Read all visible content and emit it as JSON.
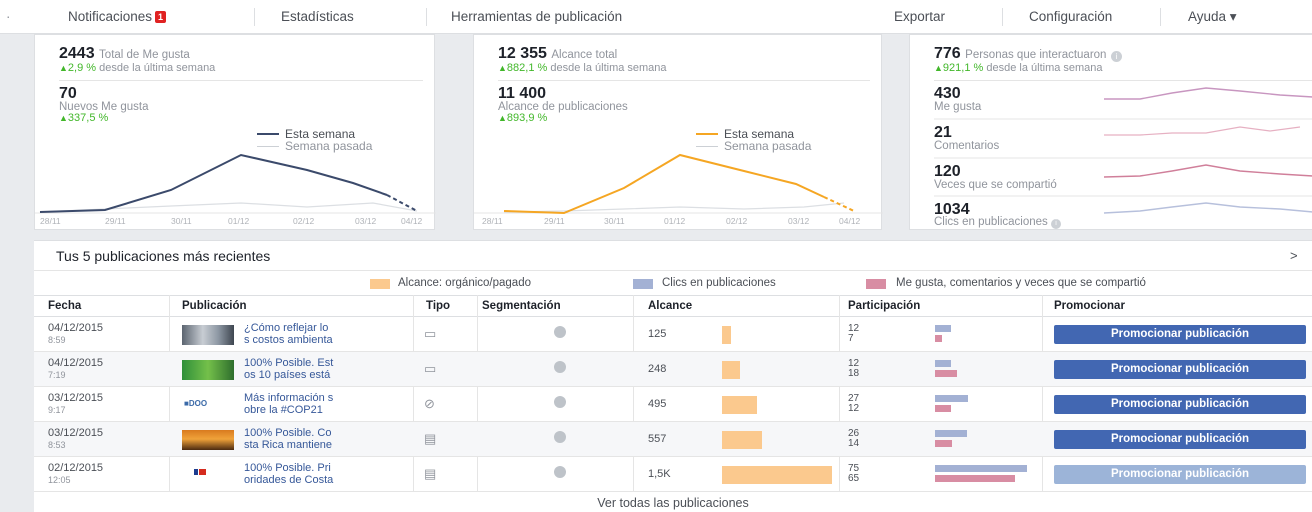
{
  "nav": {
    "notifications": "Notificaciones",
    "notifications_badge": "1",
    "stats": "Estadísticas",
    "publishing_tools": "Herramientas de publicación",
    "export": "Exportar",
    "settings": "Configuración",
    "help": "Ayuda ▾"
  },
  "likes_card": {
    "total_value": "2443",
    "total_label": "Total de Me gusta",
    "total_change": "2,9 %",
    "total_change_suffix": "desde la última semana",
    "new_value": "70",
    "new_label": "Nuevos Me gusta",
    "new_change": "337,5 %",
    "legend_this": "Esta semana",
    "legend_last": "Semana pasada",
    "axis": [
      "28/11",
      "29/11",
      "30/11",
      "01/12",
      "02/12",
      "03/12",
      "04/12"
    ],
    "line_color": "#3b4a6b"
  },
  "reach_card": {
    "total_value": "12 355",
    "total_label": "Alcance total",
    "total_change": "882,1 %",
    "total_change_suffix": "desde la última semana",
    "posts_value": "11 400",
    "posts_label": "Alcance de publicaciones",
    "posts_change": "893,9 %",
    "legend_this": "Esta semana",
    "legend_last": "Semana pasada",
    "axis": [
      "28/11",
      "29/11",
      "30/11",
      "01/12",
      "02/12",
      "03/12",
      "04/12"
    ],
    "line_color": "#f5a623"
  },
  "engagement_card": {
    "total_value": "776",
    "total_label": "Personas que interactuaron",
    "total_change": "921,1 %",
    "total_change_suffix": "desde la última semana",
    "items": [
      {
        "value": "430",
        "label": "Me gusta"
      },
      {
        "value": "21",
        "label": "Comentarios"
      },
      {
        "value": "120",
        "label": "Veces que se compartió"
      },
      {
        "value": "1034",
        "label": "Clics en publicaciones"
      }
    ]
  },
  "posts": {
    "title": "Tus 5 publicaciones más recientes",
    "chevron": ">",
    "legend": {
      "reach": "Alcance: orgánico/pagado",
      "clicks": "Clics en publicaciones",
      "reactions": "Me gusta, comentarios y veces que se compartió"
    },
    "colors": {
      "reach": "#fbc98e",
      "clicks": "#a3b1d4",
      "reactions": "#d88da3"
    },
    "headers": {
      "date": "Fecha",
      "post": "Publicación",
      "type": "Tipo",
      "targeting": "Segmentación",
      "reach": "Alcance",
      "engagement": "Participación",
      "promote": "Promocionar"
    },
    "rows": [
      {
        "date": "04/12/2015",
        "time": "8:59",
        "text1": "¿Cómo reflejar lo",
        "text2": "s costos ambienta",
        "type_icon": "status-icon",
        "reach": "125",
        "reach_fraction": 0.08,
        "clicks": "12",
        "reactions": "7",
        "clicks_fraction": 0.17,
        "reactions_fraction": 0.08,
        "promote": "Promocionar publicación",
        "promote_enabled": true
      },
      {
        "date": "04/12/2015",
        "time": "7:19",
        "text1": "100% Posible. Est",
        "text2": "os 10 países está",
        "type_icon": "status-icon",
        "reach": "248",
        "reach_fraction": 0.16,
        "clicks": "12",
        "reactions": "18",
        "clicks_fraction": 0.17,
        "reactions_fraction": 0.24,
        "promote": "Promocionar publicación",
        "promote_enabled": true
      },
      {
        "date": "03/12/2015",
        "time": "9:17",
        "text1": "Más información s",
        "text2": "obre la #COP21",
        "type_icon": "link-icon",
        "reach": "495",
        "reach_fraction": 0.32,
        "clicks": "27",
        "reactions": "12",
        "clicks_fraction": 0.36,
        "reactions_fraction": 0.17,
        "promote": "Promocionar publicación",
        "promote_enabled": true
      },
      {
        "date": "03/12/2015",
        "time": "8:53",
        "text1": "100% Posible. Co",
        "text2": "sta Rica mantiene",
        "type_icon": "note-icon",
        "reach": "557",
        "reach_fraction": 0.36,
        "clicks": "26",
        "reactions": "14",
        "clicks_fraction": 0.35,
        "reactions_fraction": 0.19,
        "promote": "Promocionar publicación",
        "promote_enabled": true
      },
      {
        "date": "02/12/2015",
        "time": "12:05",
        "text1": "100% Posible. Pri",
        "text2": "oridades de Costa",
        "type_icon": "note-icon",
        "reach": "1,5K",
        "reach_fraction": 1.0,
        "clicks": "75",
        "reactions": "65",
        "clicks_fraction": 1.0,
        "reactions_fraction": 0.87,
        "promote": "Promocionar publicación",
        "promote_enabled": false
      }
    ],
    "see_all": "Ver todas las publicaciones"
  }
}
